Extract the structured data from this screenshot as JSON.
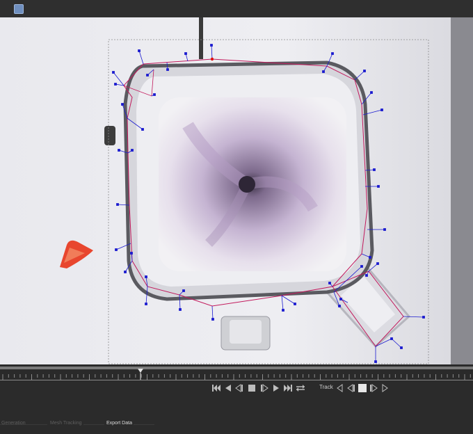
{
  "topbar": {
    "button_icon": "frame-icon",
    "button_color": "#6f8fbf"
  },
  "transport": {
    "track_label": "Track",
    "buttons": [
      "go-start",
      "step-back",
      "play-backward",
      "stop",
      "play-forward",
      "step-forward",
      "go-end",
      "toggle-loop"
    ],
    "track_buttons": [
      "track-backward",
      "track-step-backward",
      "track-stop",
      "track-step-forward",
      "track-forward"
    ]
  },
  "tabs": [
    {
      "label": "Generation",
      "state": "dim"
    },
    {
      "label": "Mesh Tracking",
      "state": "dim"
    },
    {
      "label": "Export Data",
      "state": "active"
    }
  ],
  "colors": {
    "mesh_line": "#c2185b",
    "handle": "#1a1acf",
    "selected_point": "#e01010",
    "panel": "#2b2b2b"
  }
}
